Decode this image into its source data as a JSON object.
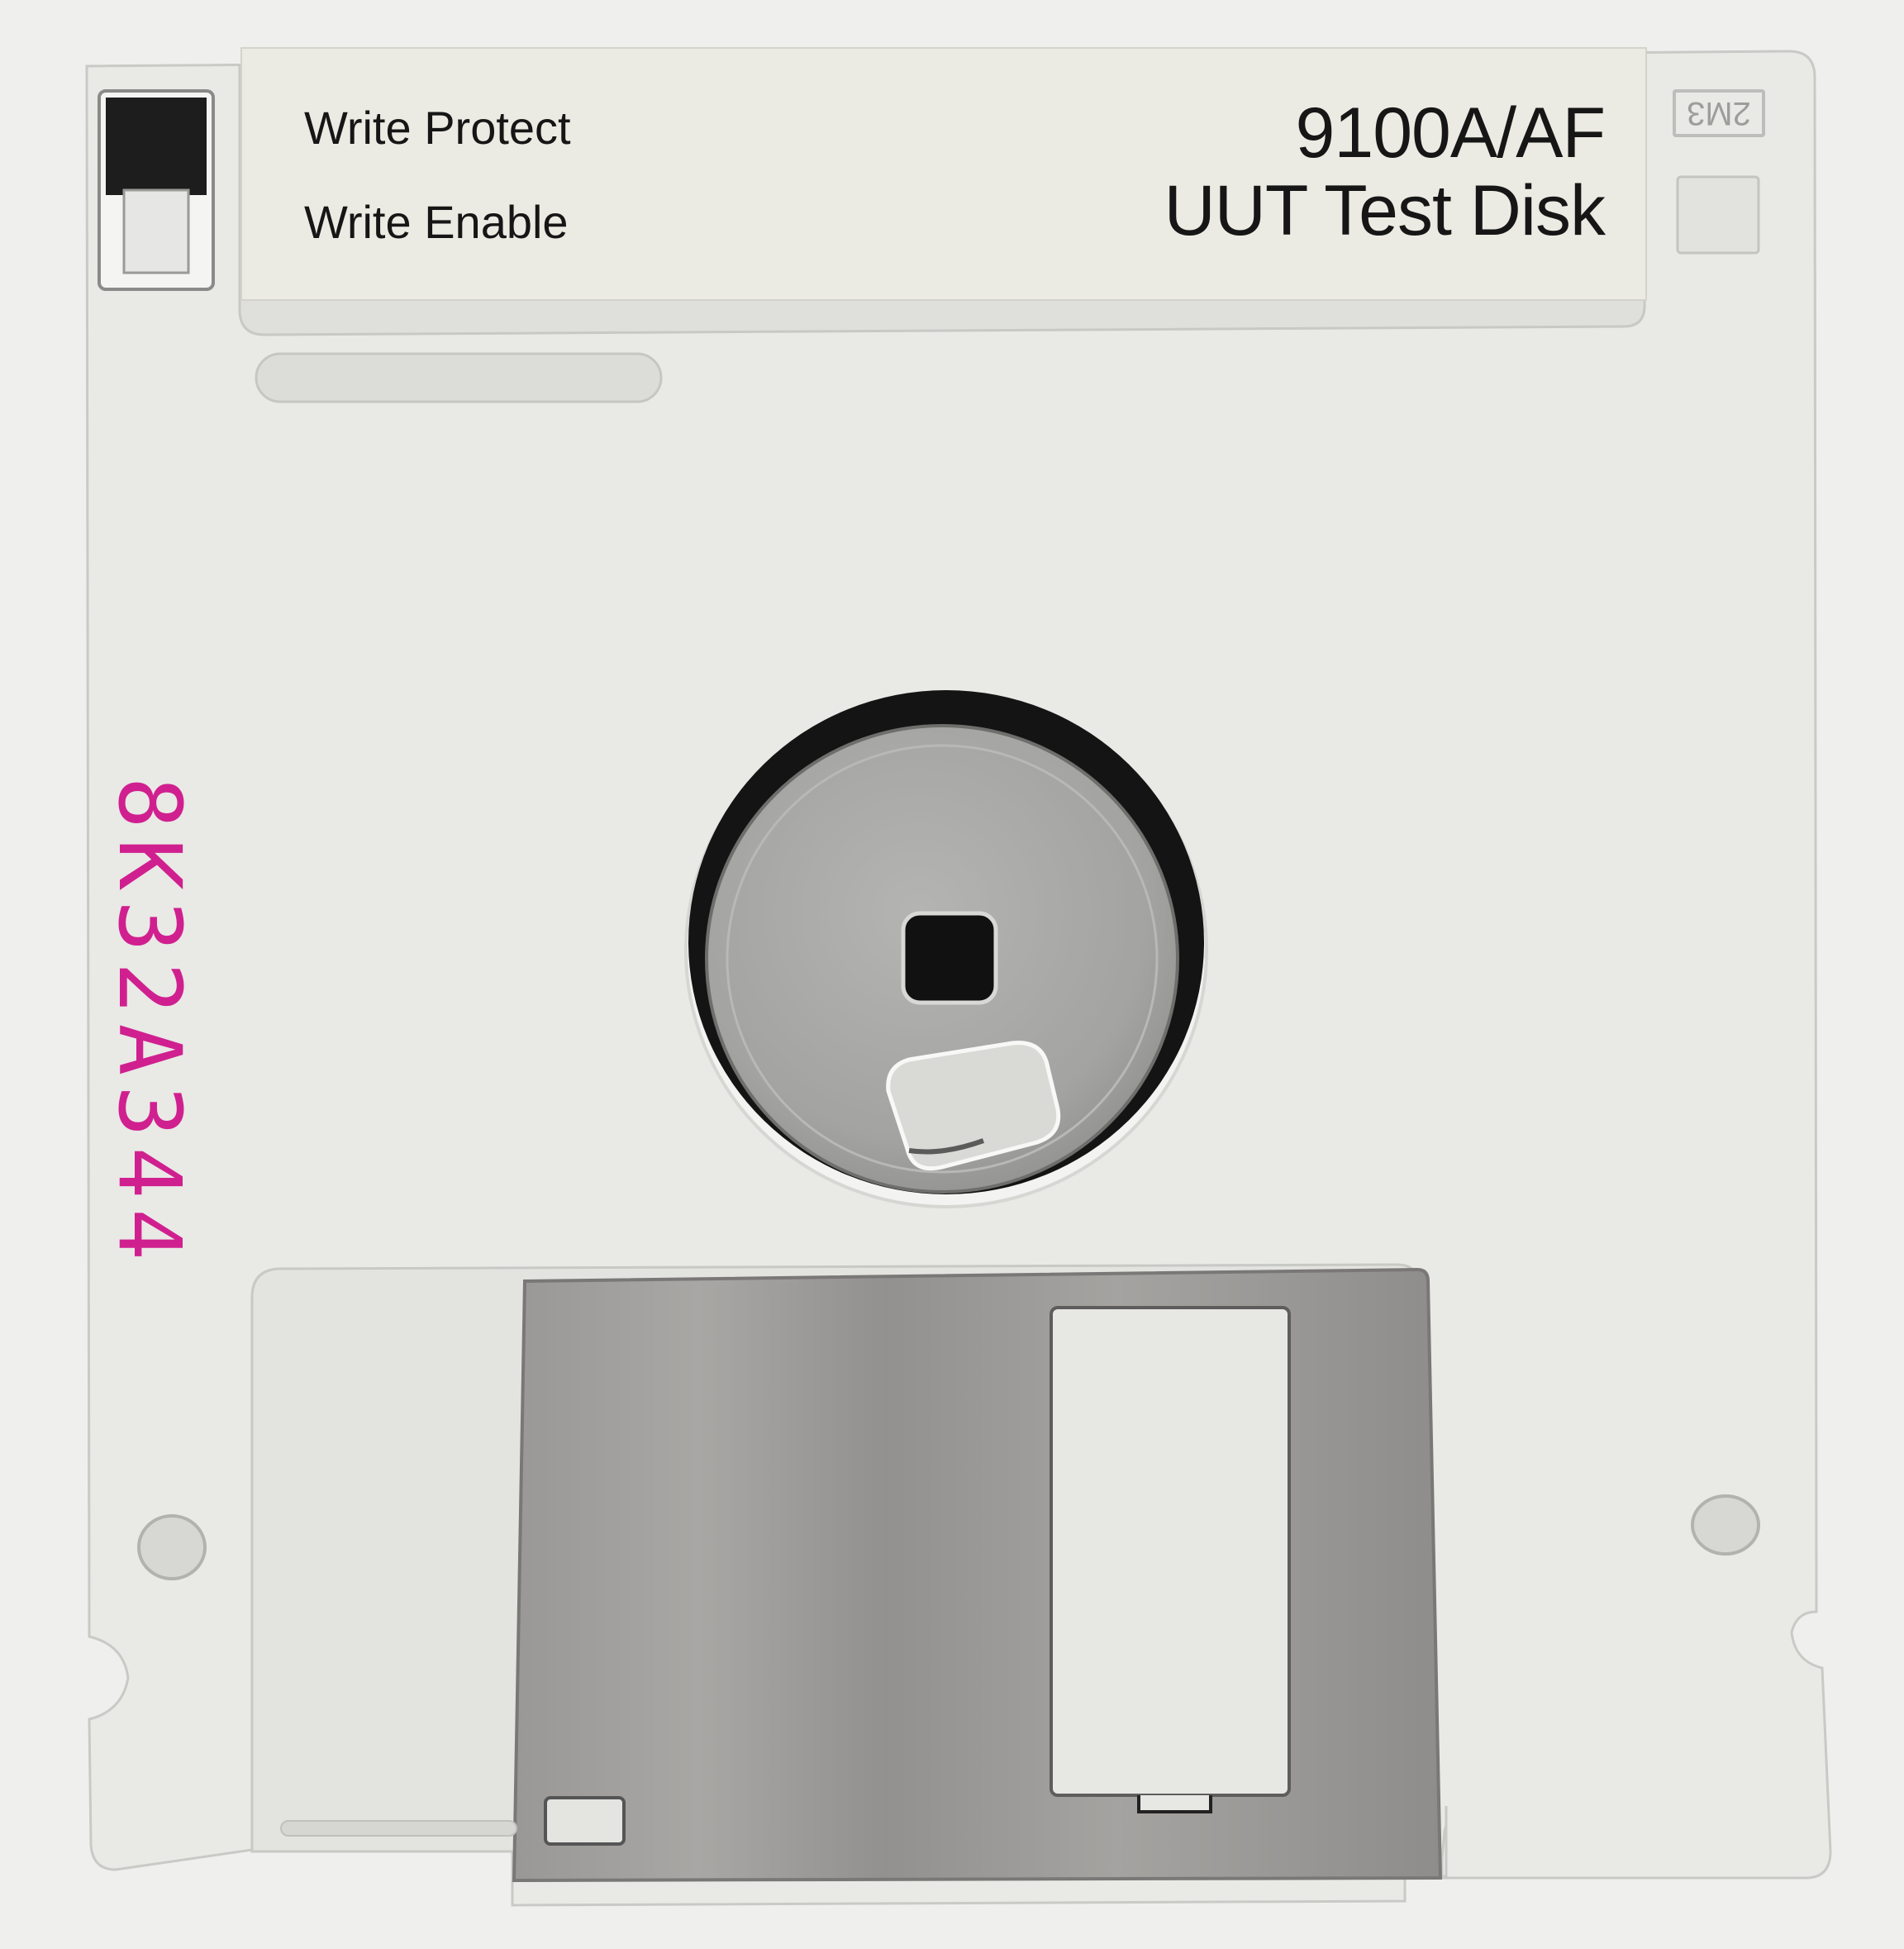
{
  "label": {
    "write_protect": "Write Protect",
    "write_enable": "Write Enable",
    "model": "9100A/AF",
    "title": "UUT Test Disk"
  },
  "corner_code": "2M3",
  "serial_number": "8K32A344",
  "colors": {
    "shell": "#e9e9e6",
    "label_paper": "#ecebe3",
    "shutter_metal": "#9a9896",
    "hub_metal": "#a8a8a6",
    "serial_ink": "#d0208f",
    "label_ink": "#161616"
  },
  "icons": {
    "write_protect_tab": "write-protect-slider-icon",
    "hub": "spindle-hub-icon",
    "shutter": "metal-shutter-icon"
  }
}
